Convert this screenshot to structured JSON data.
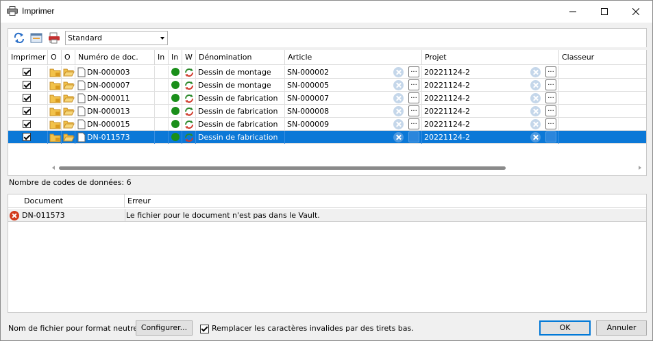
{
  "window": {
    "title": "Imprimer"
  },
  "toolbar": {
    "profile_value": "Standard"
  },
  "grid": {
    "columns": [
      "Imprimer",
      "O",
      "O",
      "Numéro de doc.",
      "In",
      "In",
      "W",
      "Dénomination",
      "Article",
      "Projet",
      "Classeur"
    ],
    "rows": [
      {
        "doc": "DN-000003",
        "name": "Dessin de montage",
        "article": "SN-000002",
        "project": "20221124-2",
        "selected": false
      },
      {
        "doc": "DN-000007",
        "name": "Dessin de montage",
        "article": "SN-000005",
        "project": "20221124-2",
        "selected": false
      },
      {
        "doc": "DN-000011",
        "name": "Dessin de fabrication",
        "article": "SN-000007",
        "project": "20221124-2",
        "selected": false
      },
      {
        "doc": "DN-000013",
        "name": "Dessin de fabrication",
        "article": "SN-000008",
        "project": "20221124-2",
        "selected": false
      },
      {
        "doc": "DN-000015",
        "name": "Dessin de fabrication",
        "article": "SN-000009",
        "project": "20221124-2",
        "selected": false
      },
      {
        "doc": "DN-011573",
        "name": "Dessin de fabrication",
        "article": "",
        "project": "20221124-2",
        "selected": true
      }
    ],
    "ellipsis": "..."
  },
  "count": {
    "text": "Nombre de codes de données: 6"
  },
  "errors": {
    "columns": [
      "Document",
      "Erreur"
    ],
    "rows": [
      {
        "document": "DN-011573",
        "error": "Le fichier pour le document n'est pas dans le Vault."
      }
    ]
  },
  "footer": {
    "neutral_label": "Nom de fichier pour format neutre:",
    "configure_button": "Configurer...",
    "replace_label": "Remplacer les caractères invalides par des tirets bas.",
    "ok_button": "OK",
    "cancel_button": "Annuler"
  },
  "colors": {
    "selection": "#0b78d7",
    "status_green": "#1a8f1a",
    "error_red": "#d23a1c"
  }
}
